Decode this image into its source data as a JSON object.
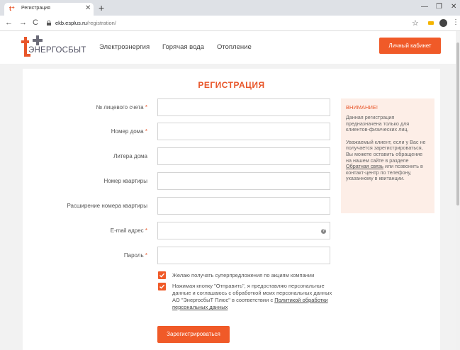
{
  "browser": {
    "tab_title": "Регистрация",
    "url_host": "ekb.esplus.ru",
    "url_path": "/registration/"
  },
  "site": {
    "logo_text": "ЭНЕРГОСБЫТ",
    "nav": [
      "Электроэнергия",
      "Горячая вода",
      "Отопление"
    ],
    "cabinet_button": "Личный кабинет"
  },
  "form": {
    "title": "РЕГИСТРАЦИЯ",
    "fields": [
      {
        "label": "№ лицевого счета",
        "required": "*",
        "value": ""
      },
      {
        "label": "Номер дома",
        "required": "*",
        "value": ""
      },
      {
        "label": "Литера дома",
        "required": "",
        "value": ""
      },
      {
        "label": "Номер квартиры",
        "required": "",
        "value": ""
      },
      {
        "label": "Расширение номера квартиры",
        "required": "",
        "value": ""
      },
      {
        "label": "E-mail адрес",
        "required": "*",
        "value": ""
      },
      {
        "label": "Пароль",
        "required": "*",
        "value": ""
      }
    ],
    "checkbox_offers": "Желаю получать суперпредложения по акциям компании",
    "checkbox_consent_text": "Нажимая кнопку \"Отправить\", я предоставляю персональные данные и соглашаюсь с обработкой моих персональных данных АО \"ЭнергосбыТ Плюс\" в соответствии с ",
    "checkbox_consent_link": "Политикой обработки персональных данных",
    "submit": "Зарегистрироваться"
  },
  "notice": {
    "title": "ВНИМАНИЕ!",
    "text1": "Данная регистрация предназначена только для клиентов-физических лиц.",
    "text2_before": "Уважаемый клиент, если у Вас не получается зарегистрироваться, Вы можете оставить обращение на нашем сайте в разделе ",
    "text2_link": "Обратная связь",
    "text2_after": " или позвонить в контакт-центр по телефону, указанному в квитанции."
  },
  "colors": {
    "accent": "#f05a28",
    "notice_bg": "#fdeee7",
    "page_bg": "#f2f2f2"
  }
}
